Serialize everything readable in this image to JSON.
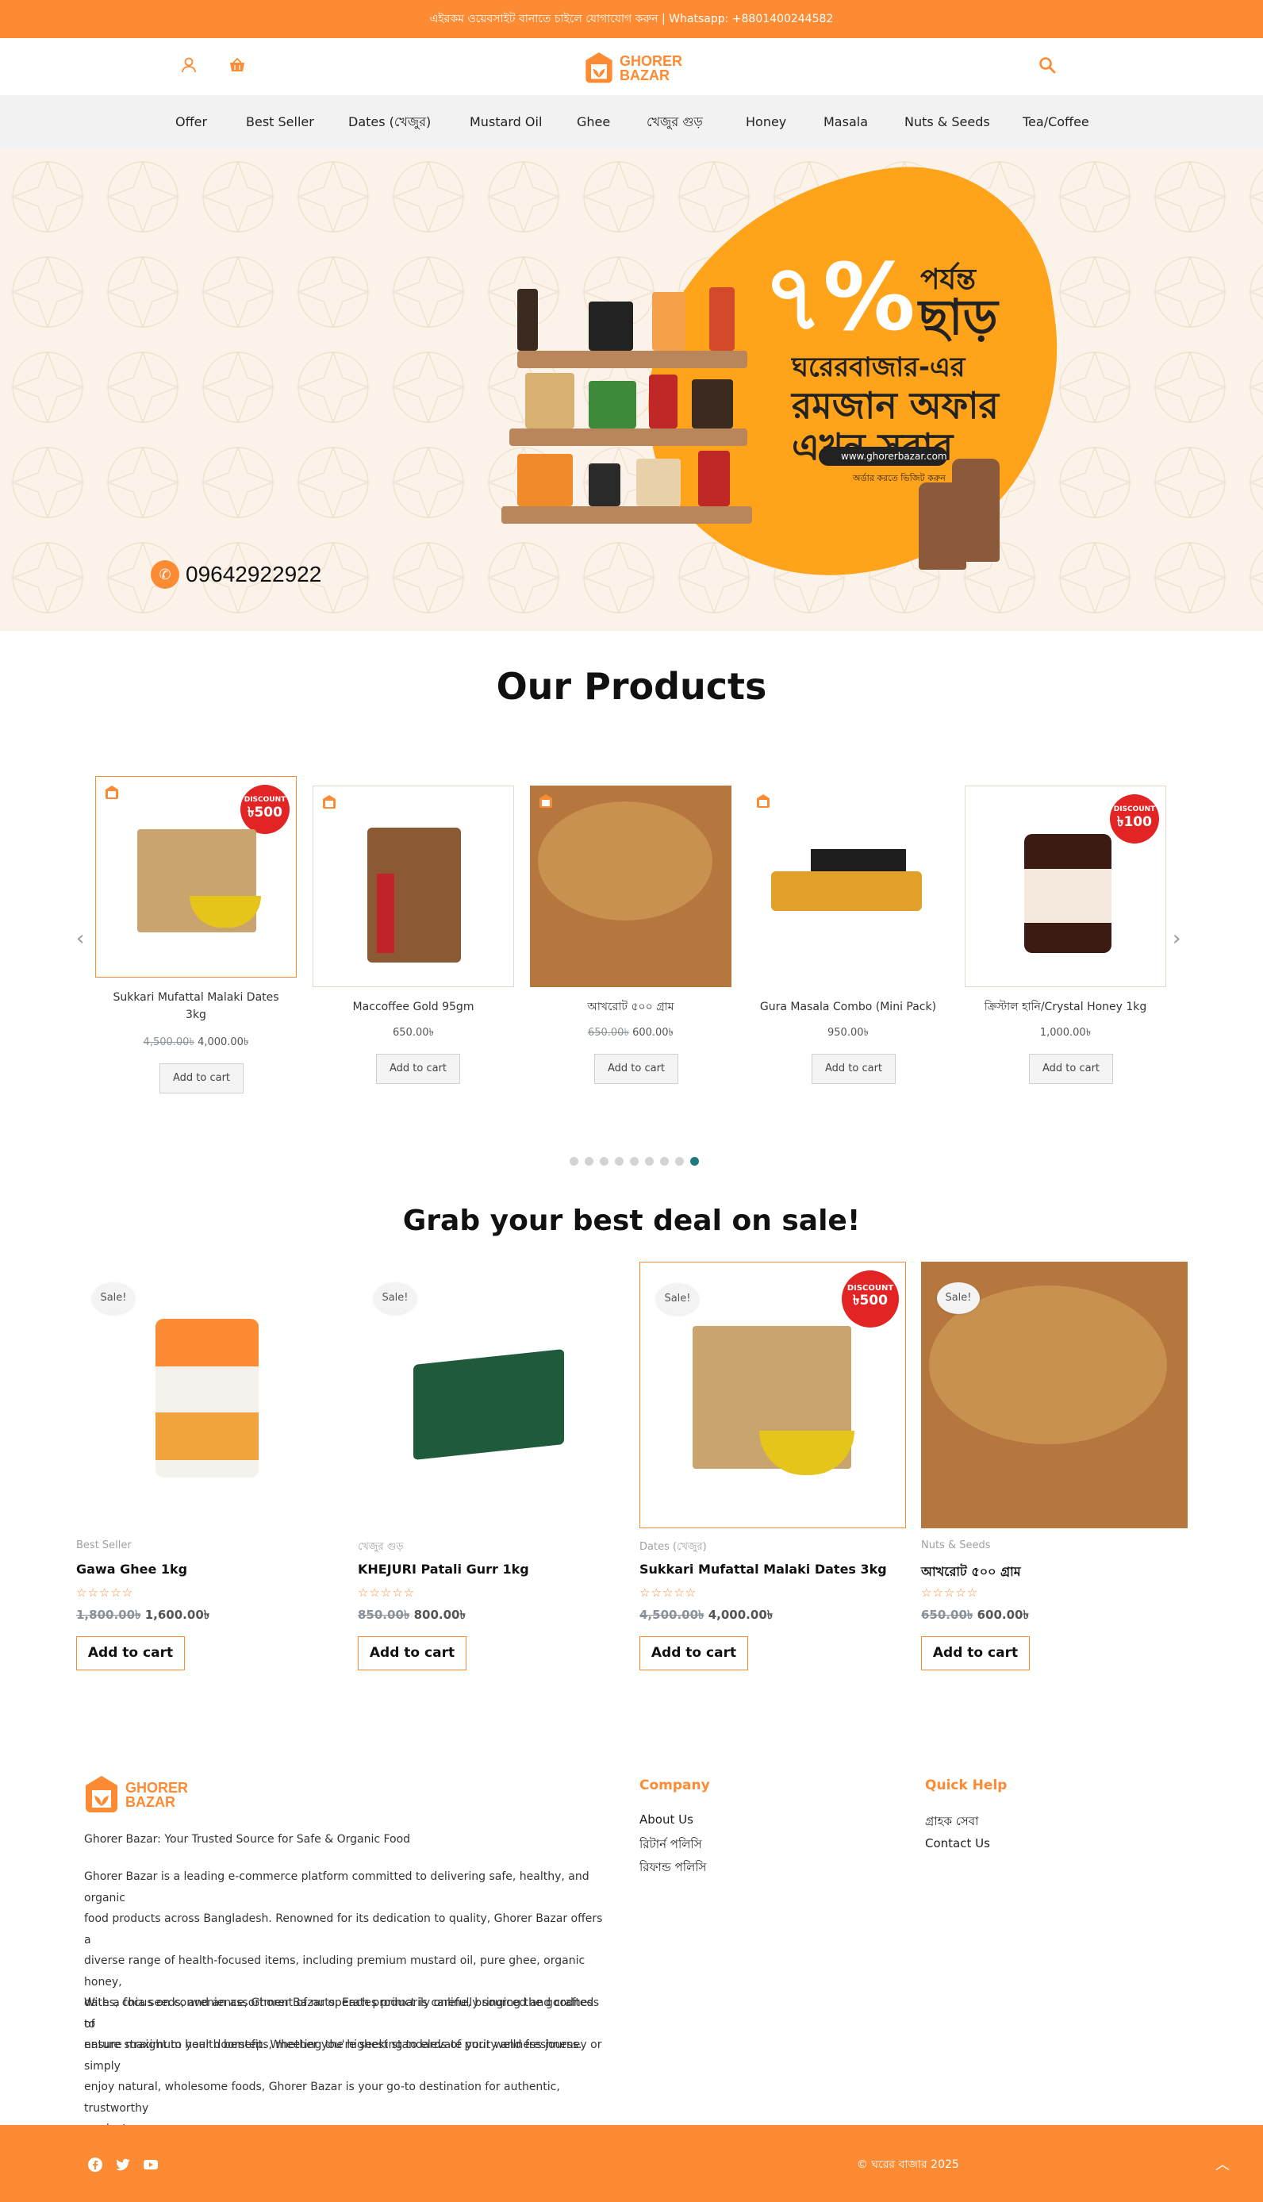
{
  "topbar": {
    "text": "এইরকম ওয়েবসাইট বানাতে চাইলে যোগাযোগ করুন |  Whatsapp: +8801400244582"
  },
  "header": {
    "user_icon": "user-icon",
    "cart_icon": "basket-icon",
    "search_icon": "search-icon",
    "logo_line1": "GHORER",
    "logo_line2": "BAZAR"
  },
  "nav": {
    "items": [
      "Offer",
      "Best Seller",
      "Dates (খেজুর)",
      "Mustard Oil",
      "Ghee",
      "খেজুর গুড়",
      "Honey",
      "Masala",
      "Nuts & Seeds",
      "Tea/Coffee"
    ]
  },
  "hero": {
    "percent": "৭%",
    "up_to": "পর্যন্ত",
    "discount": "ছাড়",
    "line1": "ঘরেরবাজার-এর",
    "line2": "রমজান অফার",
    "line3": "এখন সবার",
    "visit": "অর্ডার করতে ভিজিট করুন",
    "url": "www.ghorerbazar.com",
    "phone": "09642922922"
  },
  "products": {
    "title": "Our Products",
    "prev_icon": "chevron-left-icon",
    "next_icon": "chevron-right-icon",
    "items": [
      {
        "name_l1": "Sukkari Mufattal Malaki Dates",
        "name_l2": "3kg",
        "old": "4,500.00৳",
        "price": "4,000.00৳",
        "badge_top": "DISCOUNT",
        "badge_val": "৳500",
        "cta": "Add to cart"
      },
      {
        "name_l1": "Maccoffee Gold 95gm",
        "name_l2": "",
        "old": "",
        "price": "650.00৳",
        "badge_top": "",
        "badge_val": "",
        "cta": "Add to cart"
      },
      {
        "name_l1": "আখরোট ৫০০ গ্রাম",
        "name_l2": "",
        "old": "650.00৳",
        "price": "600.00৳",
        "badge_top": "",
        "badge_val": "",
        "cta": "Add to cart"
      },
      {
        "name_l1": "Gura Masala Combo (Mini Pack)",
        "name_l2": "",
        "old": "",
        "price": "950.00৳",
        "badge_top": "",
        "badge_val": "",
        "cta": "Add to cart"
      },
      {
        "name_l1": "ক্রিস্টাল হানি/Crystal Honey 1kg",
        "name_l2": "",
        "old": "",
        "price": "1,000.00৳",
        "badge_top": "DISCOUNT",
        "badge_val": "৳100",
        "cta": "Add to cart"
      }
    ],
    "dots_count": 9,
    "active_dot": 8
  },
  "sale": {
    "title": "Grab your best deal on sale!",
    "badge": "Sale!",
    "items": [
      {
        "category": "Best Seller",
        "name": "Gawa Ghee 1kg",
        "old": "1,800.00৳",
        "price": "1,600.00৳",
        "cta": "Add to cart"
      },
      {
        "category": "খেজুর গুড়",
        "name": "KHEJURI Patali Gurr 1kg",
        "old": "850.00৳",
        "price": "800.00৳",
        "cta": "Add to cart"
      },
      {
        "category": "Dates (খেজুর)",
        "name": "Sukkari Mufattal Malaki Dates 3kg",
        "old": "4,500.00৳",
        "price": "4,000.00৳",
        "cta": "Add to cart",
        "badge_top": "DISCOUNT",
        "badge_val": "৳500"
      },
      {
        "category": "Nuts & Seeds",
        "name": "আখরোট ৫০০ গ্রাম",
        "old": "650.00৳",
        "price": "600.00৳",
        "cta": "Add to cart"
      }
    ],
    "stars": "☆☆☆☆☆"
  },
  "footer": {
    "tagline": "Ghorer Bazar: Your Trusted Source for Safe & Organic Food",
    "p1": [
      "Ghorer Bazar is a leading e-commerce platform committed to delivering safe, healthy, and organic",
      "food products across Bangladesh. Renowned for its dedication to quality, Ghorer Bazar offers a",
      "diverse range of health-focused items, including premium mustard oil, pure ghee, organic honey,",
      "dates, chia seeds, and an assortment of nuts. Each product is carefully sourced and crafted to",
      "ensure maximum health benefits, meeting the highest standards of purity and freshness."
    ],
    "p2": [
      "With a focus on convenience, Ghorer Bazar operates primarily online, bringing the goodness of",
      "nature straight to your doorstep. Whether you're seeking to elevate your wellness journey or simply",
      "enjoy natural, wholesome foods, Ghorer Bazar is your go-to destination for authentic, trustworthy",
      "products."
    ],
    "company_title": "Company",
    "company_links": [
      "About Us",
      "রিটার্ন পলিসি",
      "রিফান্ড পলিসি"
    ],
    "help_title": "Quick Help",
    "help_links": [
      "গ্রাহক সেবা",
      "Contact Us"
    ],
    "copyright": "© ঘরের বাজার 2025",
    "social": [
      "facebook-icon",
      "twitter-icon",
      "youtube-icon"
    ]
  },
  "colors": {
    "brand": "#fd8b33",
    "discount": "#e32424",
    "dot_active": "#1e7a7f"
  }
}
